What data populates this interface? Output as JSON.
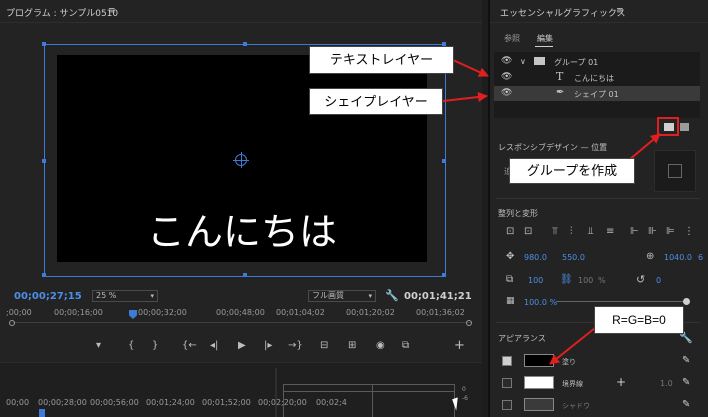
{
  "program_monitor": {
    "title": "プログラム : サンプル0510",
    "menu_glyph": "≡",
    "video_text": "こんにちは",
    "timecode_current": "00;00;27;15",
    "zoom": "25 %",
    "quality": "フル画質",
    "timecode_duration": "00;01;41;21",
    "ruler_labels": [
      ";00;00",
      "00;00;16;00",
      "00;00;32;00",
      "00;00;48;00",
      "00;01;04;02",
      "00;01;20;02",
      "00;01;36;02"
    ],
    "transport": [
      "▾",
      "{",
      "}",
      "{←",
      "◂|",
      "▶",
      "|▸",
      "→}",
      "⊟",
      "⊞",
      "◉",
      "⧉",
      "+"
    ]
  },
  "timeline": {
    "ruler_labels": [
      "00;00",
      "00;00;28;00",
      "00;00;56;00",
      "00;01;24;00",
      "00;01;52;00",
      "00;02;20;00",
      "00;02;4"
    ],
    "meter_scale": [
      "0",
      "-6"
    ]
  },
  "essential_graphics": {
    "title": "エッセンシャルグラフィックス",
    "menu_glyph": "≡",
    "tabs": [
      {
        "label": "参照",
        "active": false
      },
      {
        "label": "編集",
        "active": true
      }
    ],
    "layers": [
      {
        "label": "グループ 01",
        "icon": "folder-icon",
        "selected": false
      },
      {
        "label": "こんにちは",
        "icon": "text-icon",
        "selected": false
      },
      {
        "label": "シェイプ 01",
        "icon": "pen-icon",
        "selected": true
      }
    ],
    "responsive_label": "レスポンシブデザイン — 位置",
    "responsive_short": "追",
    "align_label": "整列と変形",
    "position": [
      "980.0",
      "550.0"
    ],
    "anchor": [
      "1040.0",
      "6"
    ],
    "scale": "100",
    "scale_unit": "%",
    "rotation": "0",
    "opacity": "100.0 %",
    "appearance_label": "アピアランス",
    "appearance": [
      {
        "label": "塗り",
        "checked": true,
        "color": "#000000"
      },
      {
        "label": "境界線",
        "checked": false,
        "color": "#ffffff",
        "value": "1.0"
      },
      {
        "label": "シャドウ",
        "checked": false,
        "color": "#3a3a3a"
      }
    ]
  },
  "annotations": {
    "text_layer": "テキストレイヤー",
    "shape_layer": "シェイプレイヤー",
    "create_group": "グループを作成",
    "rgb": "R=G=B=0"
  },
  "colors": {
    "accent": "#3d7bd6",
    "annotation": "#e02020"
  }
}
